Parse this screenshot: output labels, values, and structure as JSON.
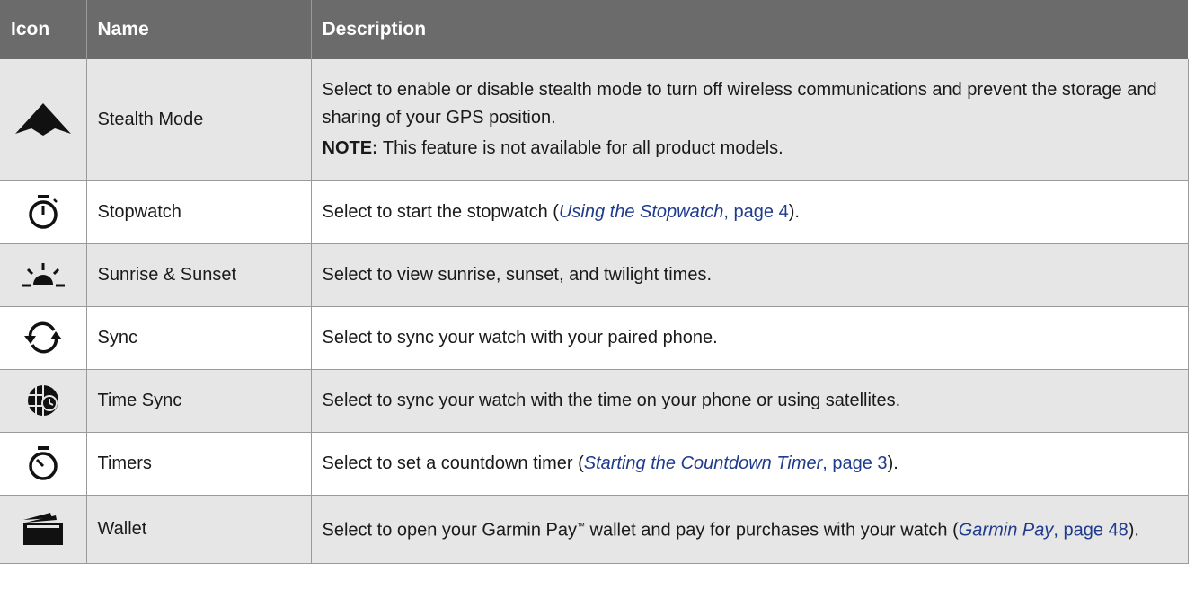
{
  "header": {
    "icon": "Icon",
    "name": "Name",
    "description": "Description"
  },
  "rows": [
    {
      "icon": "stealth-mode-icon",
      "name": "Stealth Mode",
      "desc": "Select to enable or disable stealth mode to turn off wireless communications and prevent the storage and sharing of your GPS position.",
      "note_label": "NOTE:",
      "note_text": " This feature is not available for all product models."
    },
    {
      "icon": "stopwatch-icon",
      "name": "Stopwatch",
      "desc_pre": "Select to start the stopwatch (",
      "link": "Using the Stopwatch",
      "page": ", page 4",
      "desc_post": ")."
    },
    {
      "icon": "sunrise-sunset-icon",
      "name": "Sunrise & Sunset",
      "desc": "Select to view sunrise, sunset, and twilight times."
    },
    {
      "icon": "sync-icon",
      "name": "Sync",
      "desc": "Select to sync your watch with your paired phone."
    },
    {
      "icon": "time-sync-globe-icon",
      "name": "Time Sync",
      "desc": "Select to sync your watch with the time on your phone or using satellites."
    },
    {
      "icon": "timer-icon",
      "name": "Timers",
      "desc_pre": "Select to set a countdown timer (",
      "link": "Starting the Countdown Timer",
      "page": ", page 3",
      "desc_post": ")."
    },
    {
      "icon": "wallet-icon",
      "name": "Wallet",
      "desc_pre": "Select to open your Garmin Pay",
      "tm": "™",
      "desc_mid": " wallet and pay for purchases with your watch (",
      "link": "Garmin Pay",
      "page": ", page 48",
      "desc_post": ")."
    }
  ]
}
